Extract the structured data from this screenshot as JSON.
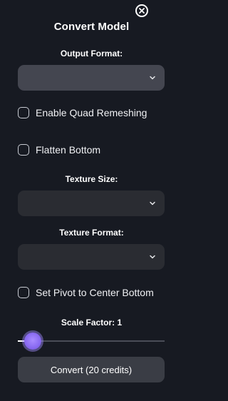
{
  "panel": {
    "title": "Convert Model"
  },
  "output_format": {
    "label": "Output Format:",
    "selected": "",
    "background": "#444650"
  },
  "options": {
    "quad_remeshing": {
      "label": "Enable Quad Remeshing",
      "checked": false
    },
    "flatten_bottom": {
      "label": "Flatten Bottom",
      "checked": false
    }
  },
  "texture_size": {
    "label": "Texture Size:",
    "selected": "",
    "background": "#2a2c32"
  },
  "texture_format": {
    "label": "Texture Format:",
    "selected": "",
    "background": "#2a2c32"
  },
  "pivot": {
    "label": "Set Pivot to Center Bottom",
    "checked": false
  },
  "scale": {
    "label": "Scale Factor: 1",
    "value": 1,
    "min": 0,
    "max": 10,
    "accent": "#8b6cf2"
  },
  "convert_button": {
    "label": "Convert (20 credits)"
  },
  "icons": {
    "close": "close-icon",
    "chevron": "chevron-down-icon"
  }
}
